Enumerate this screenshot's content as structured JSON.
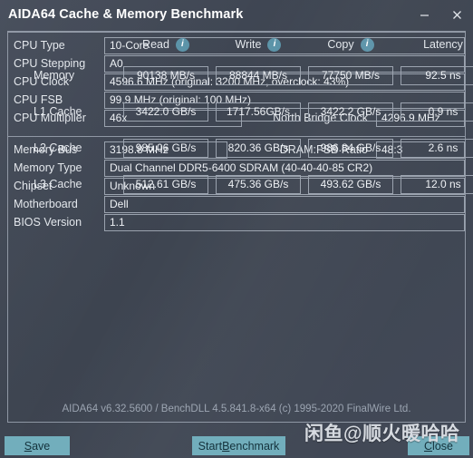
{
  "window": {
    "title": "AIDA64 Cache & Memory Benchmark",
    "minimize_icon": "minimize-icon",
    "close_icon": "close-icon"
  },
  "benchmark": {
    "columns": [
      {
        "label": "Read",
        "has_info": true,
        "info_icon": "info-icon"
      },
      {
        "label": "Write",
        "has_info": true,
        "info_icon": "info-icon"
      },
      {
        "label": "Copy",
        "has_info": true,
        "info_icon": "info-icon"
      },
      {
        "label": "Latency",
        "has_info": false
      }
    ],
    "rows": [
      {
        "label": "Memory",
        "read": "90138 MB/s",
        "write": "88844 MB/s",
        "copy": "77750 MB/s",
        "latency": "92.5 ns"
      },
      {
        "label": "L1 Cache",
        "read": "3422.0 GB/s",
        "write": "1717.56GB/s",
        "copy": "3422.2 GB/s",
        "latency": "0.9 ns"
      },
      {
        "label": "L2 Cache",
        "read": "985.06 GB/s",
        "write": "820.36 GB/s",
        "copy": "986.84 GB/s",
        "latency": "2.6 ns"
      },
      {
        "label": "L3 Cache",
        "read": "512.61 GB/s",
        "write": "475.36 GB/s",
        "copy": "493.62 GB/s",
        "latency": "12.0 ns"
      }
    ]
  },
  "cpu": {
    "type_label": "CPU Type",
    "type_value": "10-Core",
    "stepping_label": "CPU Stepping",
    "stepping_value": "A0",
    "clock_label": "CPU Clock",
    "clock_value": "4596.6 MHz  (original: 3200 MHz, overclock: 43%)",
    "fsb_label": "CPU FSB",
    "fsb_value": "99.9 MHz  (original: 100 MHz)",
    "multiplier_label": "CPU Multiplier",
    "multiplier_value": "46x",
    "north_bridge_label": "North Bridge Clock",
    "north_bridge_value": "4296.9 MHz"
  },
  "memory": {
    "bus_label": "Memory Bus",
    "bus_value": "3198.8 MHz",
    "ratio_label": "DRAM:FSB Ratio",
    "ratio_value": "48:3",
    "type_label": "Memory Type",
    "type_value": "Dual Channel DDR5-6400 SDRAM  (40-40-40-85 CR2)",
    "chipset_label": "Chipset",
    "chipset_value": "Unknown",
    "motherboard_label": "Motherboard",
    "motherboard_value": "Dell",
    "bios_label": "BIOS Version",
    "bios_value": "1.1"
  },
  "footer": {
    "version_text": "AIDA64 v6.32.5600 / BenchDLL 4.5.841.8-x64  (c) 1995-2020 FinalWire Ltd."
  },
  "buttons": {
    "save": {
      "prefix": "",
      "accel": "S",
      "suffix": "ave"
    },
    "start": {
      "prefix": "Start ",
      "accel": "B",
      "suffix": "enchmark"
    },
    "close": {
      "prefix": "",
      "accel": "C",
      "suffix": "lose"
    }
  },
  "watermark": {
    "text": "闲鱼@顺火暖哈哈"
  }
}
